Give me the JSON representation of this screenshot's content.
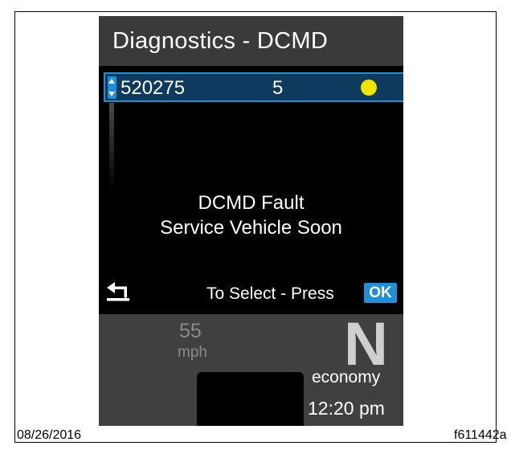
{
  "header": {
    "title": "Diagnostics - DCMD"
  },
  "fault_list": {
    "selected": {
      "code": "520275",
      "count": "5",
      "status_color": "#f3e400"
    }
  },
  "message": {
    "line1": "DCMD Fault",
    "line2": "Service Vehicle Soon"
  },
  "footer_hint": {
    "text": "To Select - Press",
    "ok_label": "OK"
  },
  "status_panel": {
    "speed_value": "55",
    "speed_unit": "mph",
    "gear": "N",
    "mode": "economy",
    "time": "12:20 pm"
  },
  "caption": {
    "date": "08/26/2016",
    "figure_id": "f611442a"
  },
  "colors": {
    "accent": "#1e90d8",
    "selected_bg": "#0e3a5e",
    "warning": "#f3e400"
  },
  "icons": {
    "back": "back-arrow-icon",
    "scroll": "up-down-arrows-icon"
  }
}
